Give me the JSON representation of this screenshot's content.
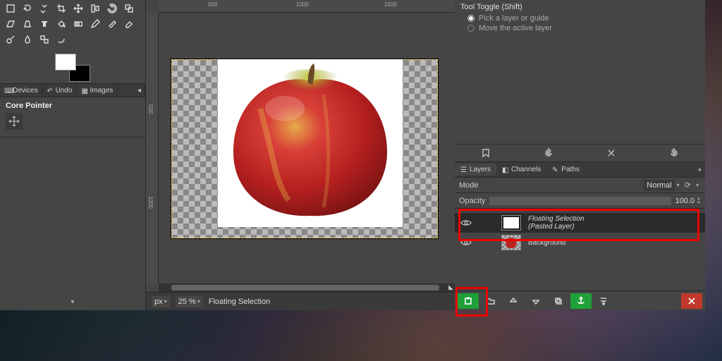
{
  "ruler_marks": {
    "h": [
      "500",
      "1000",
      "1500"
    ],
    "v": [
      "500",
      "1000"
    ]
  },
  "left": {
    "tabs": {
      "devices": "Devices",
      "undo": "Undo",
      "images": "Images"
    },
    "core_pointer": "Core Pointer"
  },
  "status": {
    "unit": "px",
    "zoom": "25 %",
    "selection": "Floating Selection"
  },
  "right": {
    "tool_toggle": {
      "title": "Tool Toggle  (Shift)",
      "opt1": "Pick a layer or guide",
      "opt2": "Move the active layer"
    },
    "tabs": {
      "layers": "Layers",
      "channels": "Channels",
      "paths": "Paths"
    },
    "mode": {
      "label": "Mode",
      "value": "Normal"
    },
    "opacity": {
      "label": "Opacity",
      "value": "100.0"
    },
    "layers": {
      "float1": "Floating Selection",
      "float2": "(Pasted Layer)",
      "background": "Background"
    }
  }
}
